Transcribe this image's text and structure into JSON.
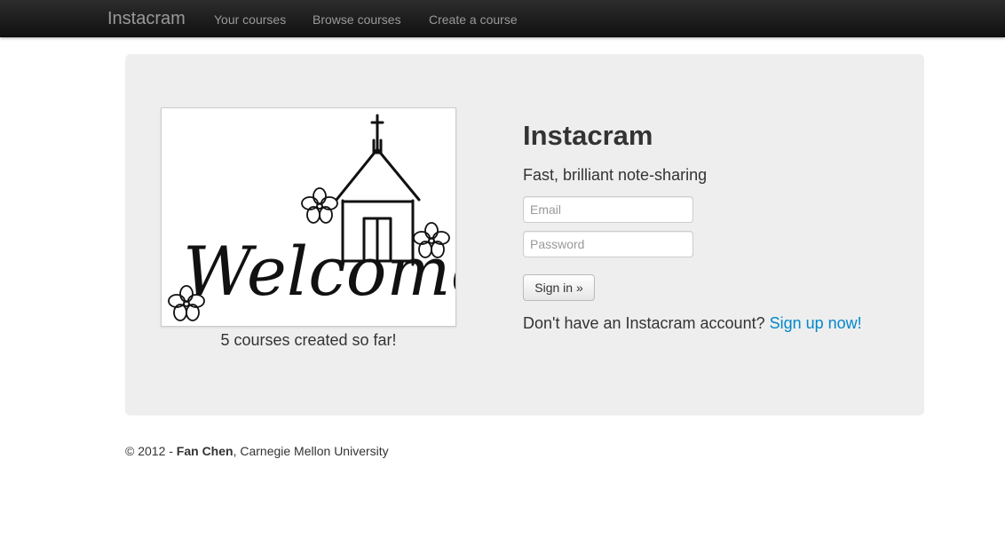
{
  "navbar": {
    "brand": "Instacram",
    "links": [
      "Your courses",
      "Browse courses",
      "Create a course"
    ]
  },
  "hero": {
    "image_text": "Welcome",
    "caption": "5 courses created so far!",
    "title": "Instacram",
    "tagline": "Fast, brilliant note-sharing",
    "email_placeholder": "Email",
    "password_placeholder": "Password",
    "signin_label": "Sign in »",
    "signup_prompt": "Don't have an Instacram account?",
    "signup_link": "Sign up now!"
  },
  "footer": {
    "prefix": "© 2012 - ",
    "author": "Fan Chen",
    "suffix": ", Carnegie Mellon University"
  },
  "colors": {
    "navbar": "#1b1b1b",
    "hero_bg": "#eeeeee",
    "link": "#0088cc"
  }
}
